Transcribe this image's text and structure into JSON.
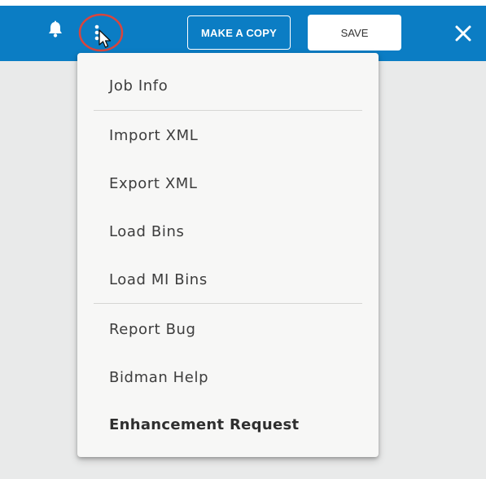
{
  "toolbar": {
    "bell_icon": "bell-icon",
    "more_icon": "more-vertical-icon",
    "make_copy_label": "MAKE A COPY",
    "save_label": "SAVE",
    "close_icon": "close-icon",
    "accent_color": "#0b7dc4"
  },
  "menu": {
    "items": [
      {
        "label": "Job Info"
      },
      {
        "label": "Import XML"
      },
      {
        "label": "Export XML"
      },
      {
        "label": "Load Bins"
      },
      {
        "label": "Load MI Bins"
      },
      {
        "label": "Report Bug"
      },
      {
        "label": "Bidman Help"
      },
      {
        "label": "Enhancement Request"
      }
    ]
  },
  "annotation": {
    "highlight_color": "#d9453d"
  }
}
